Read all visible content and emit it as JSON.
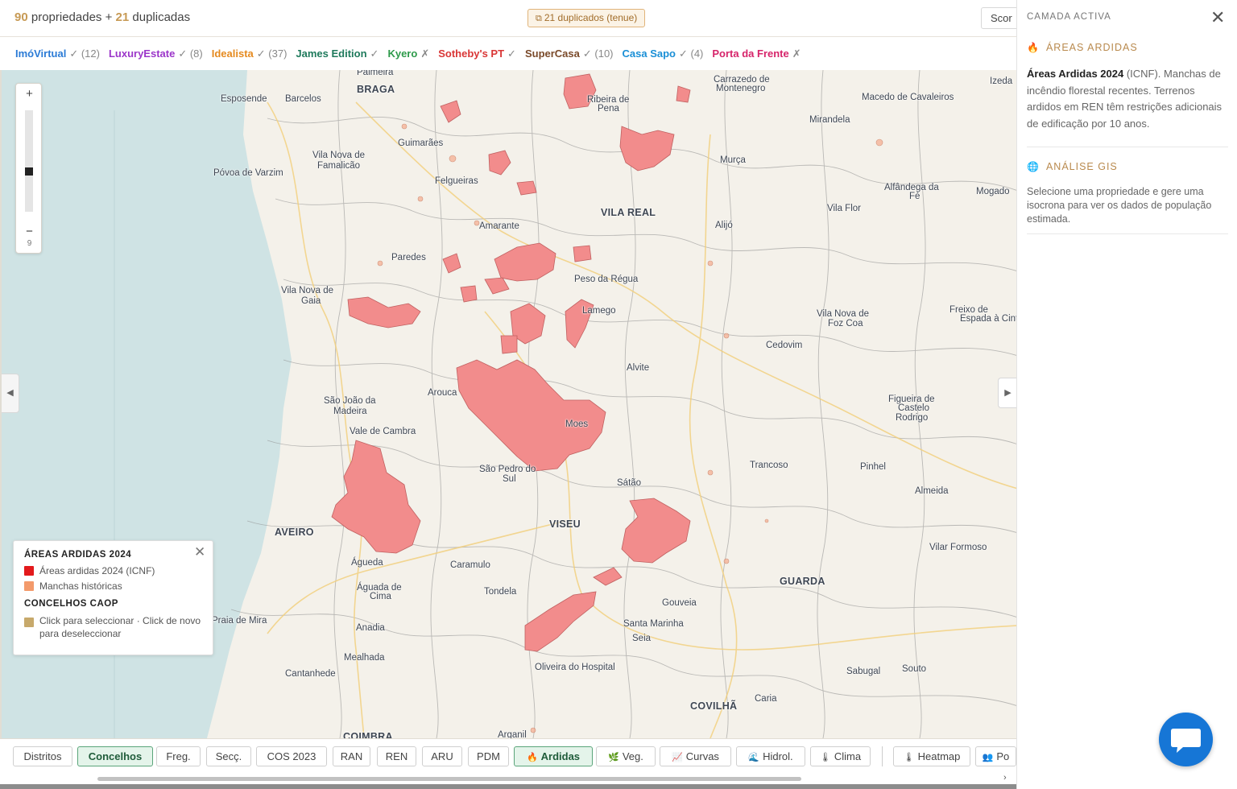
{
  "header": {
    "count_num": "90",
    "count_text": "propriedades +",
    "dup_num": "21",
    "dup_text": "duplicadas",
    "dup_badge": "21 duplicados (tenue)",
    "score_label": "Scor"
  },
  "sources": [
    {
      "name": "ImóVirtual",
      "status": "✓ (12)",
      "color": "#2b7bd6"
    },
    {
      "name": "LuxuryEstate",
      "status": "✓ (8)",
      "color": "#9b35c9"
    },
    {
      "name": "Idealista",
      "status": "✓ (37)",
      "color": "#e58a1f"
    },
    {
      "name": "James Edition",
      "status": "✓",
      "color": "#1f7a5c"
    },
    {
      "name": "Kyero",
      "status": "✗",
      "color": "#2d9a4a"
    },
    {
      "name": "Sotheby's PT",
      "status": "✓",
      "color": "#d93636"
    },
    {
      "name": "SuperCasa",
      "status": "✓ (10)",
      "color": "#7a4a2a"
    },
    {
      "name": "Casa Sapo",
      "status": "✓ (4)",
      "color": "#1a8fd6"
    },
    {
      "name": "Porta da Frente",
      "status": "✗",
      "color": "#d6246a"
    }
  ],
  "map": {
    "zoom_in": "+",
    "zoom_out": "−",
    "zoom_level": "9",
    "left_toggle": "◀",
    "right_toggle": "▶",
    "places": [
      {
        "t": "Palmeira",
        "big": false
      },
      {
        "t": "BRAGA",
        "big": true
      },
      {
        "t": "Esposende",
        "big": false
      },
      {
        "t": "Barcelos",
        "big": false
      },
      {
        "t": "Guimarães",
        "big": false
      },
      {
        "t": "Vila Nova de",
        "big": false
      },
      {
        "t": "Famalicão",
        "big": false
      },
      {
        "t": "Póvoa de Varzim",
        "big": false
      },
      {
        "t": "Felgueiras",
        "big": false
      },
      {
        "t": "Amarante",
        "big": false
      },
      {
        "t": "Paredes",
        "big": false
      },
      {
        "t": "Vila Nova de",
        "big": false
      },
      {
        "t": "Gaia",
        "big": false
      },
      {
        "t": "Ribeira de",
        "big": false
      },
      {
        "t": "Pena",
        "big": false
      },
      {
        "t": "Carrazedo de",
        "big": false
      },
      {
        "t": "Montenegro",
        "big": false
      },
      {
        "t": "Izeda",
        "big": false
      },
      {
        "t": "Macedo de Cavaleiros",
        "big": false
      },
      {
        "t": "Mirandela",
        "big": false
      },
      {
        "t": "Murça",
        "big": false
      },
      {
        "t": "VILA REAL",
        "big": true
      },
      {
        "t": "Alijó",
        "big": false
      },
      {
        "t": "Alfândega da",
        "big": false
      },
      {
        "t": "Fé",
        "big": false
      },
      {
        "t": "Mogado",
        "big": false
      },
      {
        "t": "Vila Flor",
        "big": false
      },
      {
        "t": "Peso da Régua",
        "big": false
      },
      {
        "t": "Lamego",
        "big": false
      },
      {
        "t": "Freixo de",
        "big": false
      },
      {
        "t": "Espada à Cinta",
        "big": false
      },
      {
        "t": "Vila Nova de",
        "big": false
      },
      {
        "t": "Foz Coa",
        "big": false
      },
      {
        "t": "Cedovim",
        "big": false
      },
      {
        "t": "Alvite",
        "big": false
      },
      {
        "t": "Arouca",
        "big": false
      },
      {
        "t": "São João da",
        "big": false
      },
      {
        "t": "Madeira",
        "big": false
      },
      {
        "t": "Vale de Cambra",
        "big": false
      },
      {
        "t": "Moes",
        "big": false
      },
      {
        "t": "Figueira de",
        "big": false
      },
      {
        "t": "Castelo",
        "big": false
      },
      {
        "t": "Rodrigo",
        "big": false
      },
      {
        "t": "Trancoso",
        "big": false
      },
      {
        "t": "Pinhel",
        "big": false
      },
      {
        "t": "Almeida",
        "big": false
      },
      {
        "t": "São Pedro do",
        "big": false
      },
      {
        "t": "Sul",
        "big": false
      },
      {
        "t": "Sátão",
        "big": false
      },
      {
        "t": "AVEIRO",
        "big": true
      },
      {
        "t": "VISEU",
        "big": true
      },
      {
        "t": "Vilar Formoso",
        "big": false
      },
      {
        "t": "Águeda",
        "big": false
      },
      {
        "t": "Caramulo",
        "big": false
      },
      {
        "t": "GUARDA",
        "big": true
      },
      {
        "t": "Águada de",
        "big": false
      },
      {
        "t": "Cima",
        "big": false
      },
      {
        "t": "Tondela",
        "big": false
      },
      {
        "t": "Gouveia",
        "big": false
      },
      {
        "t": "Praia de Mira",
        "big": false
      },
      {
        "t": "Anadia",
        "big": false
      },
      {
        "t": "Santa Marinha",
        "big": false
      },
      {
        "t": "Seia",
        "big": false
      },
      {
        "t": "Mealhada",
        "big": false
      },
      {
        "t": "Cantanhede",
        "big": false
      },
      {
        "t": "Oliveira do Hospital",
        "big": false
      },
      {
        "t": "Sabugal",
        "big": false
      },
      {
        "t": "Souto",
        "big": false
      },
      {
        "t": "Caria",
        "big": false
      },
      {
        "t": "COVILHÃ",
        "big": true
      },
      {
        "t": "Arganil",
        "big": false
      },
      {
        "t": "COIMBRA",
        "big": true
      }
    ]
  },
  "legend": {
    "title1": "ÁREAS ARDIDAS 2024",
    "item1": "Áreas ardidas 2024 (ICNF)",
    "item1_color": "#e31a1c",
    "item2": "Manchas históricas",
    "item2_color": "#f39a6b",
    "title2": "CONCELHOS CAOP",
    "item3": "Click para seleccionar · Click de novo para deseleccionar",
    "item3_color": "#c7a96b",
    "close": "✕"
  },
  "toolbar": {
    "buttons": [
      {
        "label": "Distritos",
        "icon": "",
        "active": false
      },
      {
        "label": "Concelhos",
        "icon": "",
        "active": true
      },
      {
        "label": "Freg.",
        "icon": "",
        "active": false
      },
      {
        "label": "Secç.",
        "icon": "",
        "active": false
      },
      {
        "label": "COS 2023",
        "icon": "",
        "active": false
      },
      {
        "label": "RAN",
        "icon": "",
        "active": false
      },
      {
        "label": "REN",
        "icon": "",
        "active": false
      },
      {
        "label": "ARU",
        "icon": "",
        "active": false
      },
      {
        "label": "PDM",
        "icon": "",
        "active": false
      },
      {
        "label": "Ardidas",
        "icon": "🔥",
        "active": true
      },
      {
        "label": "Veg.",
        "icon": "🌿",
        "active": false
      },
      {
        "label": "Curvas",
        "icon": "📈",
        "active": false
      },
      {
        "label": "Hidrol.",
        "icon": "🌊",
        "active": false
      },
      {
        "label": "Clima",
        "icon": "🌡",
        "active": false
      },
      {
        "label": "Heatmap",
        "icon": "🌡",
        "active": false
      },
      {
        "label": "Po",
        "icon": "👥",
        "active": false
      }
    ]
  },
  "panel": {
    "header": "CAMADA ACTIVA",
    "close": "✕",
    "sec1_title": "ÁREAS ARDIDAS",
    "sec1_icon": "flame-icon",
    "sec1_bold": "Áreas Ardidas 2024",
    "sec1_text": " (ICNF). Manchas de incêndio florestal recentes. Terrenos ardidos em REN têm restrições adicionais de edificação por 10 anos.",
    "sec2_title": "ANÁLISE GIS",
    "sec2_icon": "globe-icon",
    "sec2_text": "Selecione uma propriedade e gere uma isocrona para ver os dados de população estimada."
  },
  "colors": {
    "accent": "#c79a55",
    "burn": "#f28c8c",
    "burn_stroke": "#c06060",
    "sea": "#cfe3e4"
  }
}
